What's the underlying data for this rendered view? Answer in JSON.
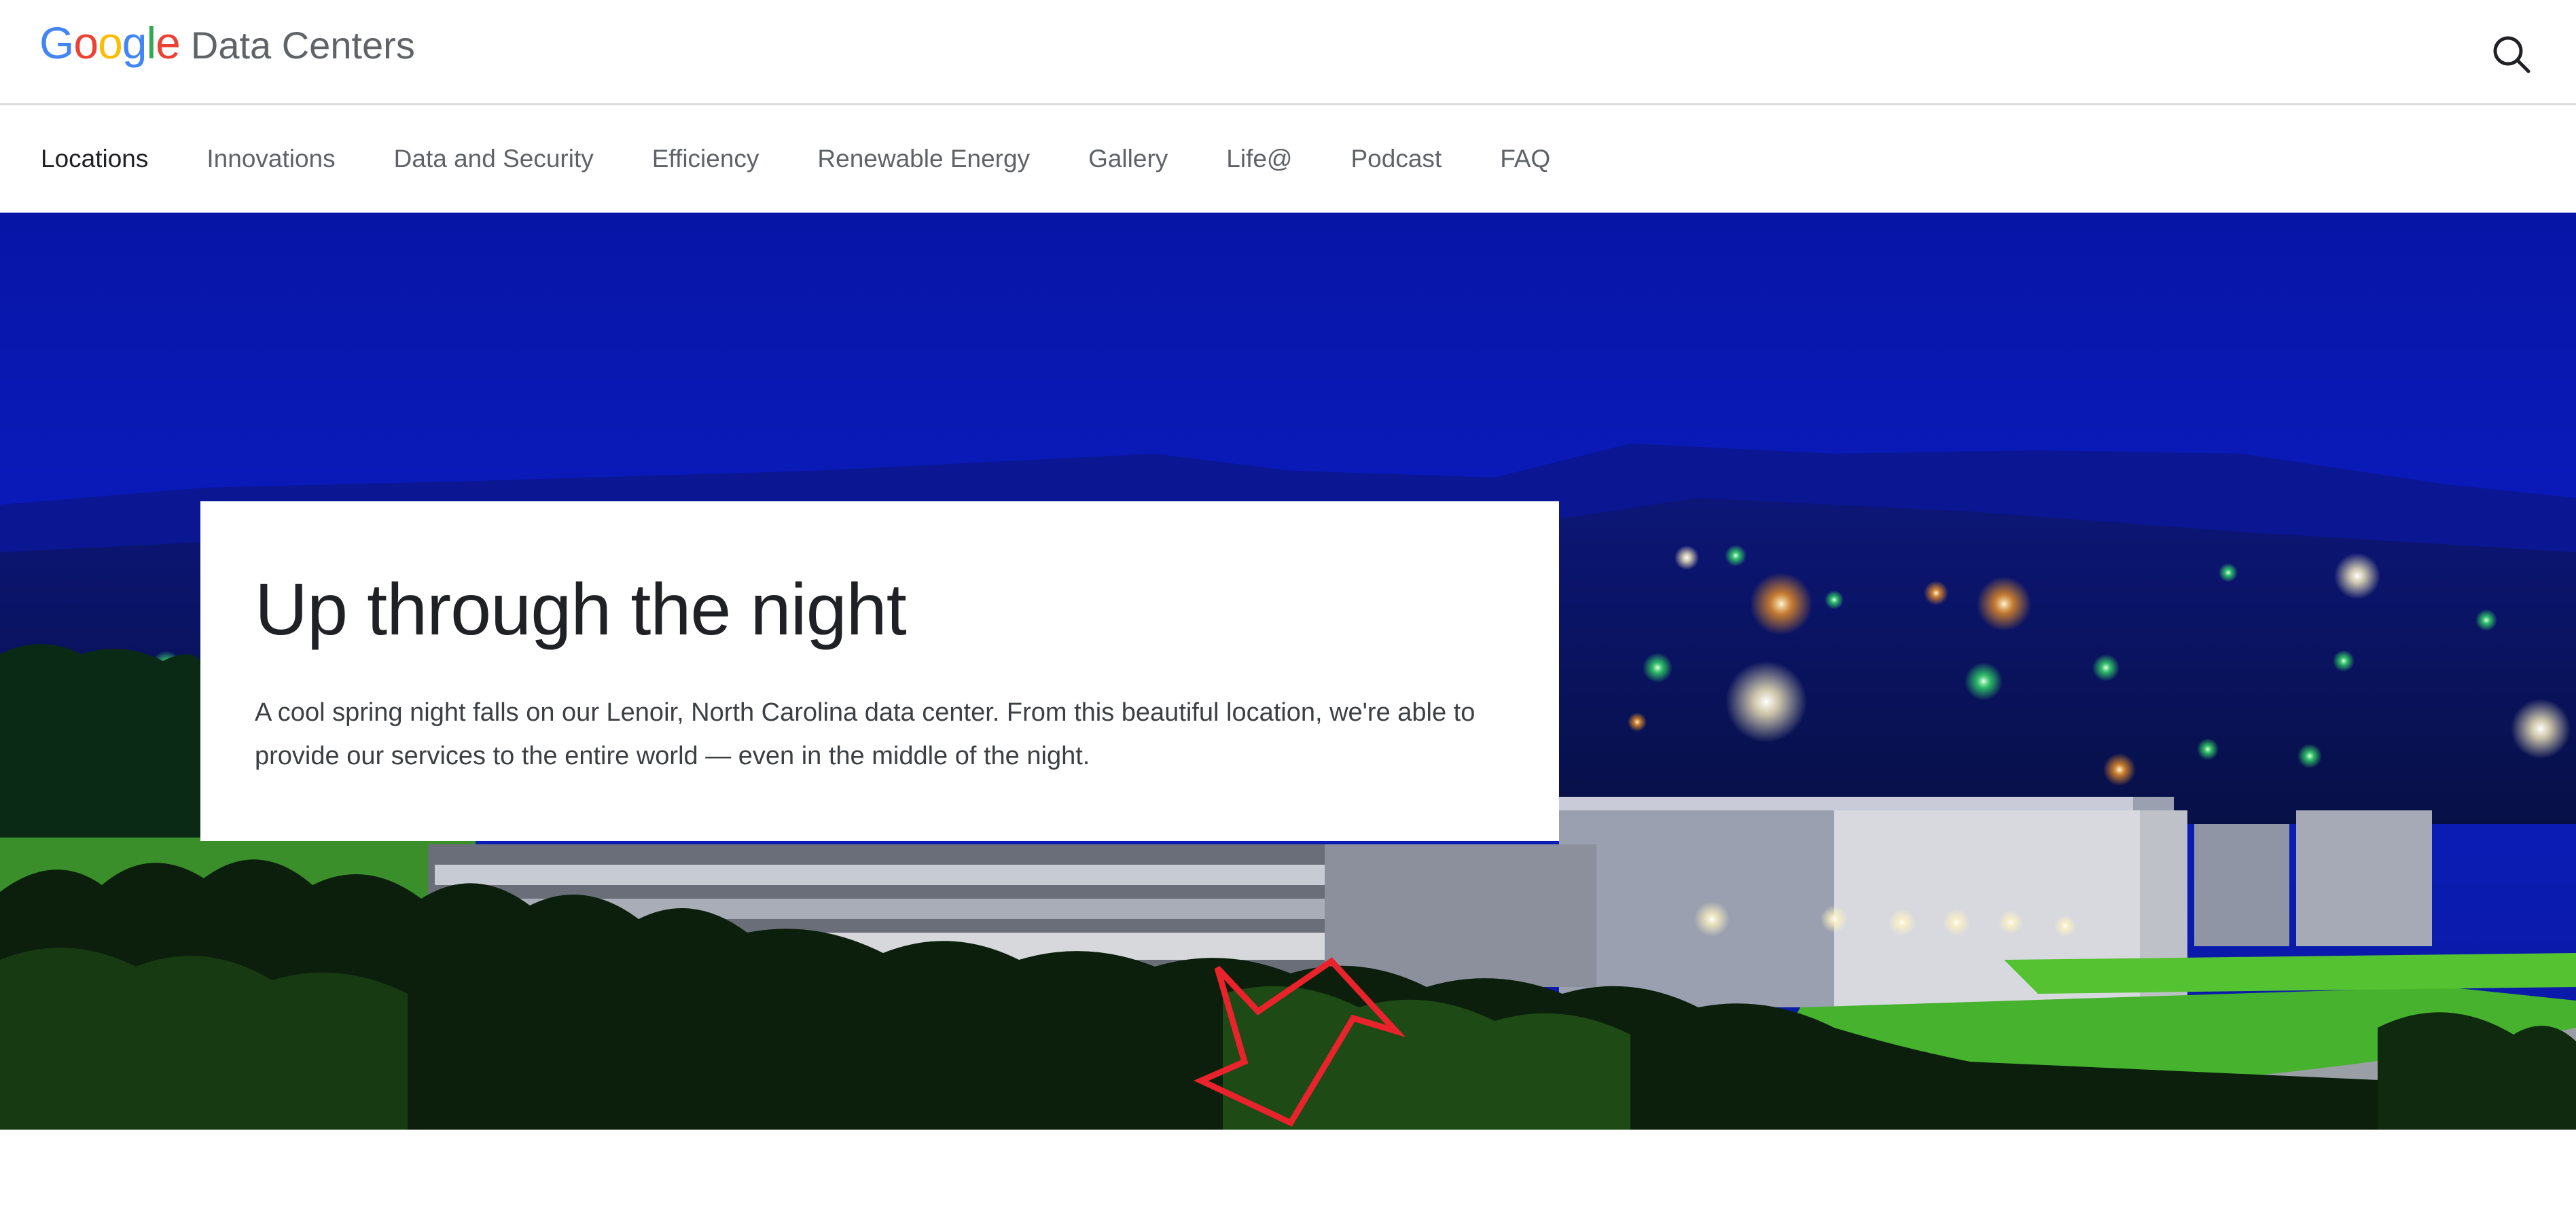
{
  "header": {
    "logo": {
      "letters": [
        "G",
        "o",
        "o",
        "g",
        "l",
        "e"
      ],
      "colors": [
        "#4285F4",
        "#EA4335",
        "#FBBC05",
        "#4285F4",
        "#34A853",
        "#EA4335"
      ]
    },
    "brand_name": "Data Centers",
    "search_icon": "search-icon"
  },
  "nav": {
    "items": [
      {
        "label": "Locations",
        "active": true
      },
      {
        "label": "Innovations",
        "active": false
      },
      {
        "label": "Data and Security",
        "active": false
      },
      {
        "label": "Efficiency",
        "active": false
      },
      {
        "label": "Renewable Energy",
        "active": false
      },
      {
        "label": "Gallery",
        "active": false
      },
      {
        "label": "Life@",
        "active": false
      },
      {
        "label": "Podcast",
        "active": false
      },
      {
        "label": "FAQ",
        "active": false
      }
    ]
  },
  "hero": {
    "title": "Up through the night",
    "description": "A cool spring night falls on our Lenoir, North Carolina data center. From this beautiful location, we're able to provide our services to the entire world — even in the middle of the night.",
    "annotation_color": "#E8232B"
  },
  "colors": {
    "sky": "#0a17b0",
    "lawn": "#3fa82a",
    "text_primary": "#202124",
    "text_secondary": "#5f6368"
  }
}
